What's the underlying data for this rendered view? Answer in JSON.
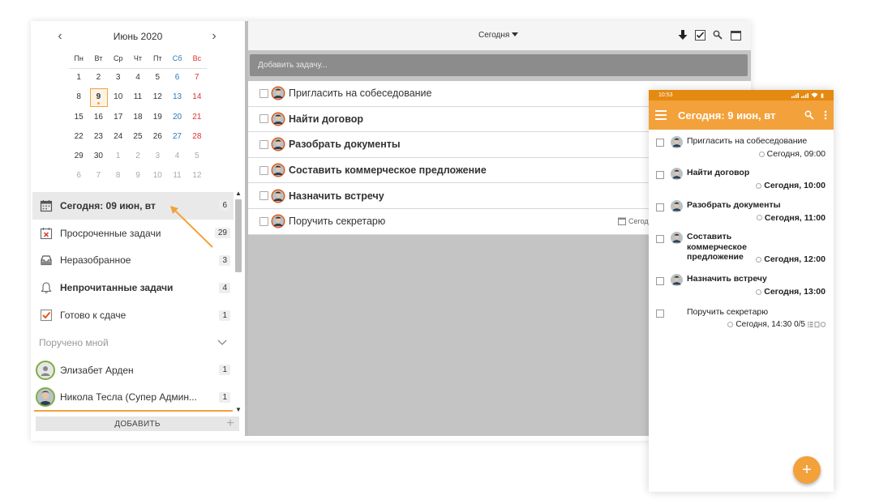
{
  "calendar": {
    "month_label": "Июнь 2020",
    "prev": "‹",
    "next": "›",
    "weekdays": [
      "Пн",
      "Вт",
      "Ср",
      "Чт",
      "Пт",
      "Сб",
      "Вс"
    ],
    "weeks": [
      [
        "1",
        "2",
        "3",
        "4",
        "5",
        "6",
        "7"
      ],
      [
        "8",
        "9",
        "10",
        "11",
        "12",
        "13",
        "14"
      ],
      [
        "15",
        "16",
        "17",
        "18",
        "19",
        "20",
        "21"
      ],
      [
        "22",
        "23",
        "24",
        "25",
        "26",
        "27",
        "28"
      ],
      [
        "29",
        "30",
        "1",
        "2",
        "3",
        "4",
        "5"
      ],
      [
        "6",
        "7",
        "8",
        "9",
        "10",
        "11",
        "12"
      ]
    ],
    "today": "9"
  },
  "nav": {
    "today": {
      "label": "Сегодня: 09 июн, вт",
      "count": "6"
    },
    "overdue": {
      "label": "Просроченные задачи",
      "count": "29"
    },
    "unsorted": {
      "label": "Неразобранное",
      "count": "3"
    },
    "unread": {
      "label": "Непрочитанные задачи",
      "count": "4"
    },
    "ready": {
      "label": "Готово к сдаче",
      "count": "1"
    },
    "assigned_by_me": {
      "label": "Поручено мной"
    },
    "user1": {
      "label": "Элизабет Арден",
      "count": "1"
    },
    "user2": {
      "label": "Никола Тесла (Супер Админ...",
      "count": "1"
    }
  },
  "sidebar": {
    "add_button": "ДОБАВИТЬ",
    "add_plus": "+"
  },
  "toolbar": {
    "view_label": "Сегодня",
    "add_task_placeholder": "Добавить задачу..."
  },
  "tasks": [
    {
      "title": "Пригласить на собеседование"
    },
    {
      "title": "Найти договор"
    },
    {
      "title": "Разобрать документы"
    },
    {
      "title": "Составить коммерческое предложение"
    },
    {
      "title": "Назначить встречу"
    },
    {
      "title": "Поручить секретарю",
      "meta": "Сегод"
    }
  ],
  "phone": {
    "time": "10:53",
    "battery": "▮",
    "title": "Сегодня: 9 июн, вт",
    "fab": "+",
    "tasks": [
      {
        "title": "Пригласить на собеседование",
        "time": "Сегодня, 09:00"
      },
      {
        "title": "Найти договор",
        "time": "Сегодня, 10:00"
      },
      {
        "title": "Разобрать документы",
        "time": "Сегодня, 11:00"
      },
      {
        "title": "Составить коммерческое предложение",
        "time": "Сегодня, 12:00"
      },
      {
        "title": "Назначить встречу",
        "time": "Сегодня, 13:00"
      },
      {
        "title": "Поручить секретарю",
        "time": "Сегодня, 14:30 0/5"
      }
    ]
  },
  "colors": {
    "accent": "#f3a13b",
    "accent_dark": "#e58a11",
    "saturday": "#2a7ab9",
    "sunday": "#dd3333",
    "overdue_icon": "#d33",
    "ready_check": "#e05a1a",
    "avatar_ring": "#7cae42"
  },
  "icons": {
    "today": "calendar-icon",
    "overdue": "calendar-x-icon",
    "unsorted": "inbox-icon",
    "unread": "bell-icon",
    "ready": "checkbox-checked-icon",
    "download": "arrow-down-icon",
    "check": "checkbox-icon",
    "search": "search-icon",
    "calendar": "calendar-icon",
    "menu": "hamburger-icon",
    "more": "more-vert-icon"
  }
}
